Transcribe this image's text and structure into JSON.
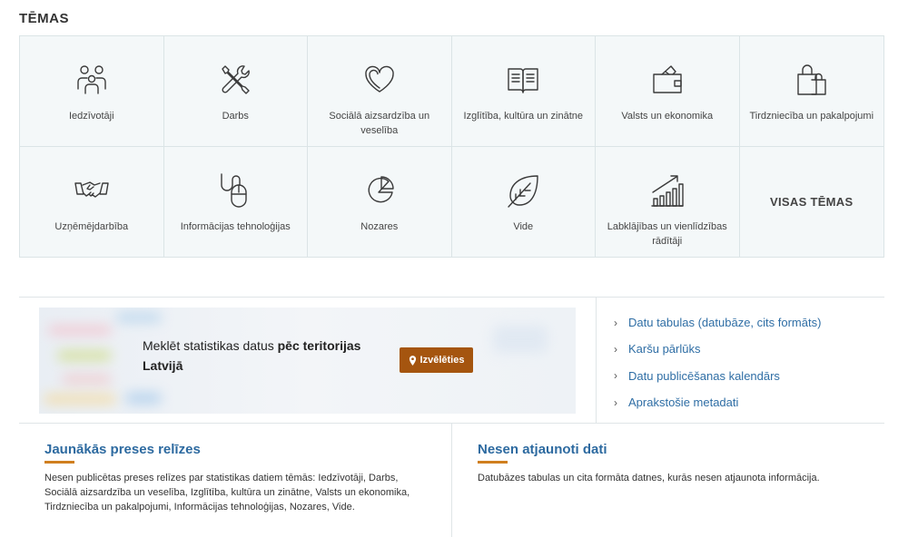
{
  "section_title": "TĒMAS",
  "topics": [
    {
      "label": "Iedzīvotāji",
      "icon": "people-icon"
    },
    {
      "label": "Darbs",
      "icon": "tools-icon"
    },
    {
      "label": "Sociālā aizsardzība un veselība",
      "icon": "heart-icon"
    },
    {
      "label": "Izglītība, kultūra un zinātne",
      "icon": "book-icon"
    },
    {
      "label": "Valsts un ekonomika",
      "icon": "wallet-icon"
    },
    {
      "label": "Tirdzniecība un pakalpojumi",
      "icon": "shopping-bag-icon"
    },
    {
      "label": "Uzņēmējdarbība",
      "icon": "handshake-icon"
    },
    {
      "label": "Informācijas tehnoloģijas",
      "icon": "mouse-icon"
    },
    {
      "label": "Nozares",
      "icon": "pie-chart-icon"
    },
    {
      "label": "Vide",
      "icon": "leaf-icon"
    },
    {
      "label": "Labklājības un vienlīdzības rādītāji",
      "icon": "growth-chart-icon"
    }
  ],
  "all_topics_label": "VISAS TĒMAS",
  "banner": {
    "text_regular": "Meklēt statistikas datus ",
    "text_bold": "pēc teritorijas",
    "text_line2": "Latvijā",
    "button_label": "Izvēlēties",
    "button_icon": "map-pin-icon",
    "button_color": "#a5550f"
  },
  "quick_links": [
    "Datu tabulas (datubāze, cits formāts)",
    "Karšu pārlūks",
    "Datu publicēšanas kalendārs",
    "Aprakstošie metadati"
  ],
  "news": {
    "left": {
      "title": "Jaunākās preses relīzes",
      "text": "Nesen publicētas preses relīzes par statistikas datiem tēmās: Iedzīvotāji, Darbs, Sociālā aizsardzība un veselība, Izglītība, kultūra un zinātne, Valsts un ekonomika, Tirdzniecība un pakalpojumi, Informācijas tehnoloģijas, Nozares, Vide."
    },
    "right": {
      "title": "Nesen atjaunoti dati",
      "text": "Datubāzes tabulas un cita formāta datnes, kurās nesen atjaunota informācija."
    }
  },
  "colors": {
    "link": "#2f6ea5",
    "accent_underline": "#d07f1e",
    "tile_bg": "#f4f8f9"
  }
}
